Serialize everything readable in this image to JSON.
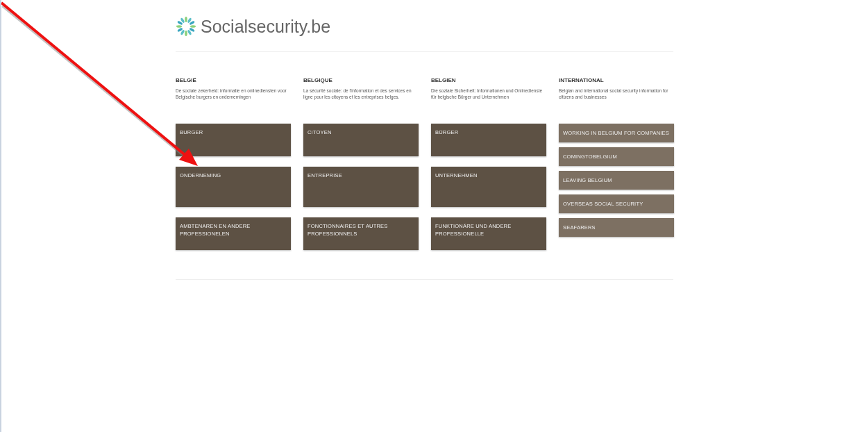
{
  "header": {
    "logo_text": "Socialsecurity.be"
  },
  "columns": [
    {
      "title": "BELGIË",
      "description": "De sociale zekerheid: informatie en onlinediensten voor Belgische burgers en ondernemingen",
      "kind": "main",
      "links": [
        {
          "label": "BURGER"
        },
        {
          "label": "ONDERNEMING"
        },
        {
          "label": "AMBTENAREN EN ANDERE PROFESSIONELEN"
        }
      ]
    },
    {
      "title": "BELGIQUE",
      "description": "La sécurité sociale: de l'information et des services en ligne pour les citoyens et les entreprises belges.",
      "kind": "main",
      "links": [
        {
          "label": "CITOYEN"
        },
        {
          "label": "ENTREPRISE"
        },
        {
          "label": "FONCTIONNAIRES ET AUTRES PROFESSIONNELS"
        }
      ]
    },
    {
      "title": "BELGIEN",
      "description": "Die soziale Sicherheit: Informationen und Onlinedienste für belgische Bürger und Unternehmen",
      "kind": "main",
      "links": [
        {
          "label": "BÜRGER"
        },
        {
          "label": "UNTERNEHMEN"
        },
        {
          "label": "FUNKTIONÄRE UND ANDERE PROFESSIONELLE"
        }
      ]
    },
    {
      "title": "INTERNATIONAL",
      "description": "Belgian and international social security information for citizens and businesses",
      "kind": "international",
      "links": [
        {
          "label": "WORKING IN BELGIUM FOR COMPANIES"
        },
        {
          "label": "COMINGTOBELGIUM"
        },
        {
          "label": "LEAVING BELGIUM"
        },
        {
          "label": "OVERSEAS SOCIAL SECURITY"
        },
        {
          "label": "SEAFARERS"
        }
      ]
    }
  ]
}
